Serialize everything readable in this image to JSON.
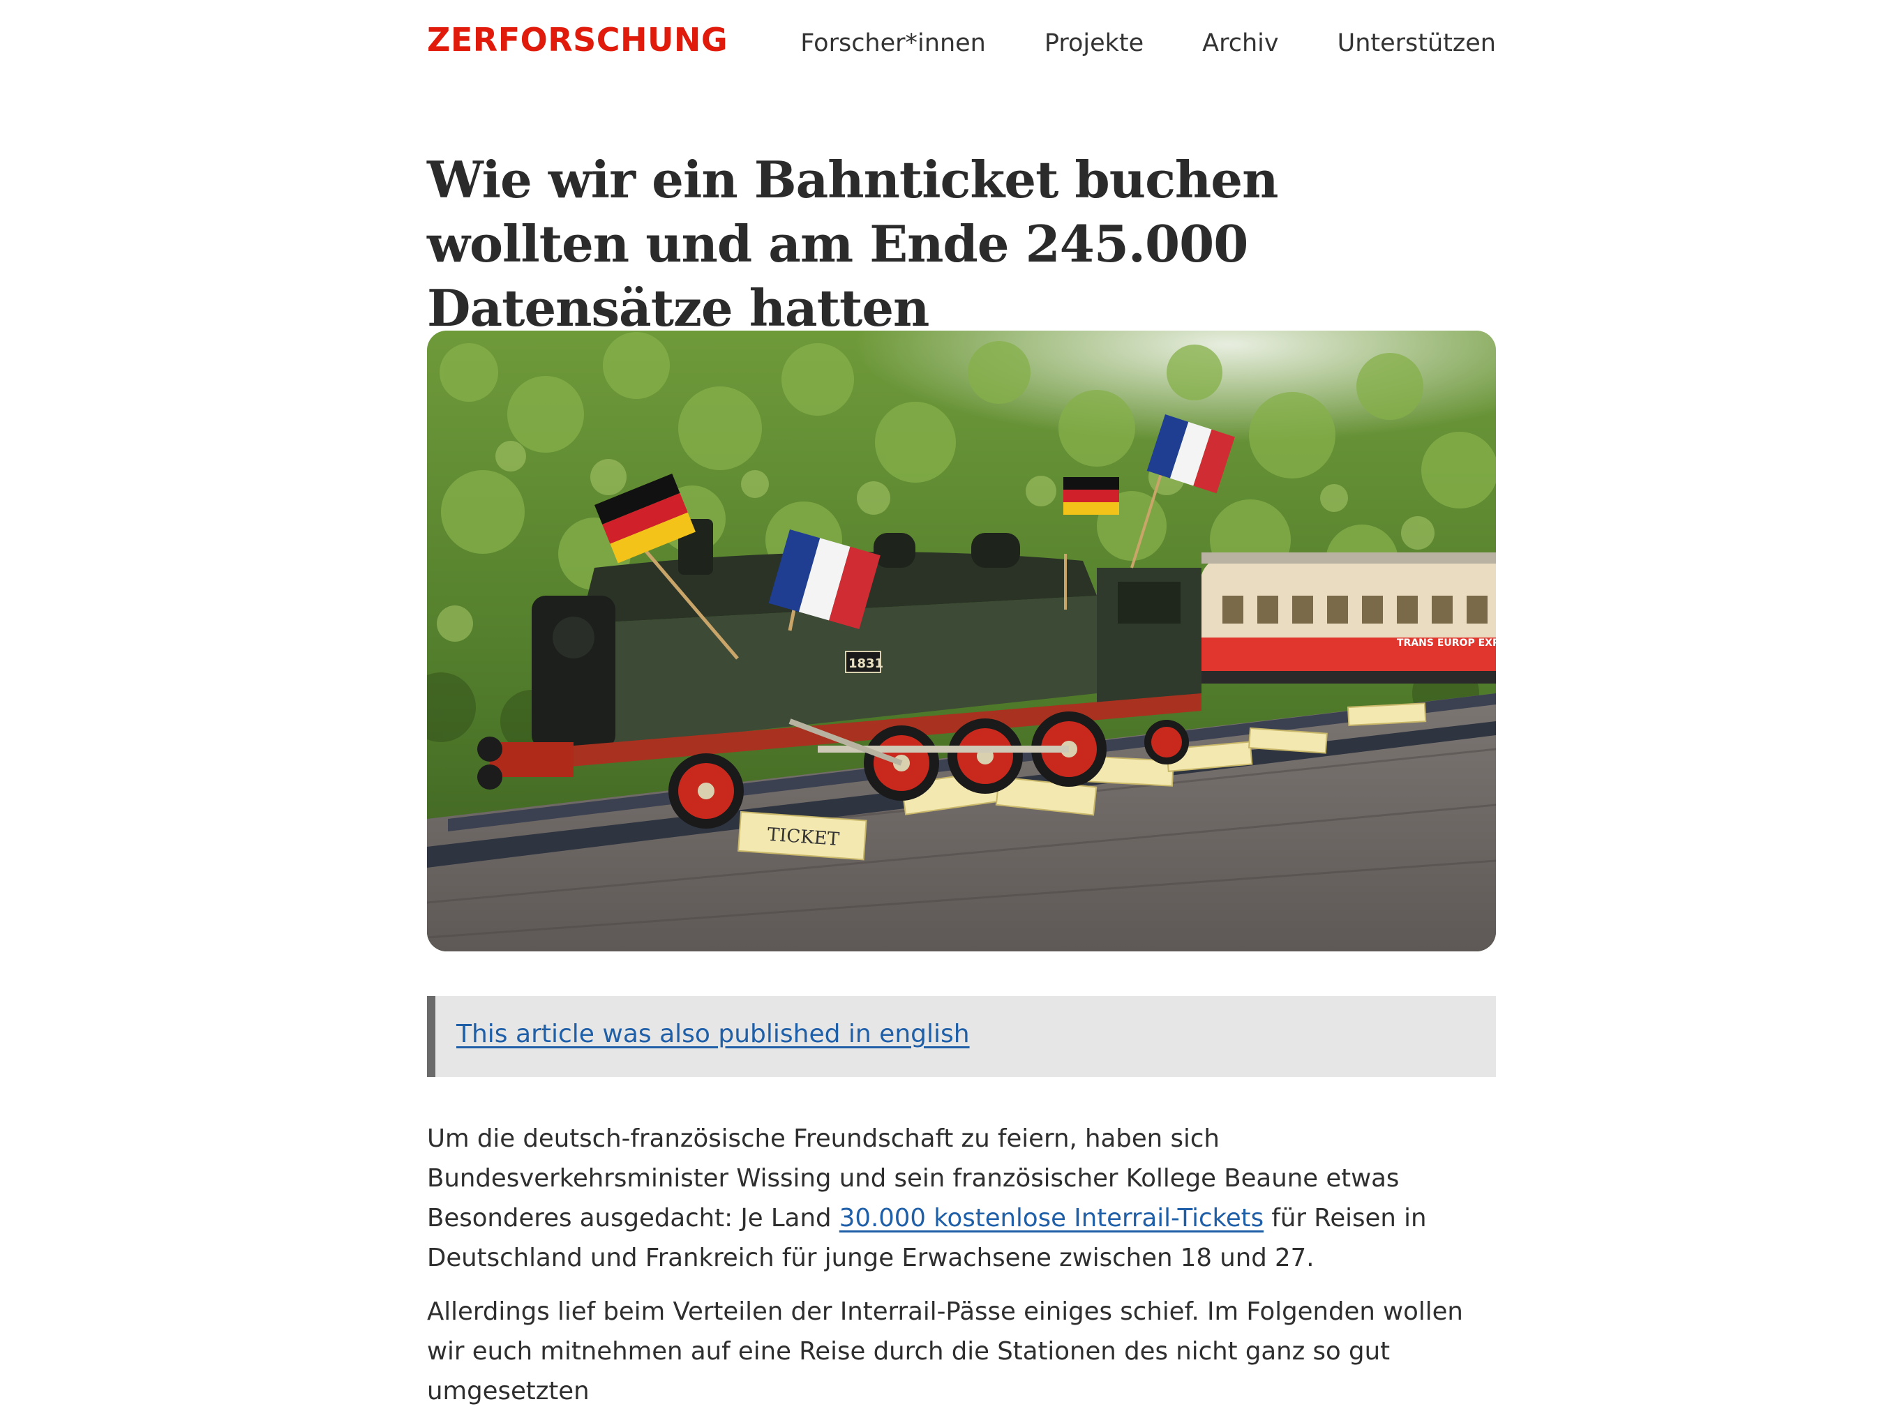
{
  "header": {
    "logo": "ZERFORSCHUNG",
    "nav": [
      {
        "label": "Forscher*innen"
      },
      {
        "label": "Projekte"
      },
      {
        "label": "Archiv"
      },
      {
        "label": "Unterstützen"
      }
    ]
  },
  "article": {
    "title": "Wie wir ein Bahnticket buchen wollten und am Ende 245.000 Datensätze hatten",
    "hero": {
      "locomotive_number": "1831",
      "ticket_label": "TICKET",
      "coach_label": "TRANS EUROP EXP"
    },
    "callout_link": "This article was also published in english",
    "p1_before": "Um die deutsch-französische Freundschaft zu feiern, haben sich Bundesverkehrsminister Wissing und sein französischer Kollege Beaune etwas Besonderes ausgedacht: Je Land ",
    "p1_link": "30.000 kostenlose Interrail-Tickets",
    "p1_after": " für Reisen in Deutschland und Frankreich für junge Erwachsene zwischen 18 und 27.",
    "p2": "Allerdings lief beim Verteilen der Interrail-Pässe einiges schief. Im Folgenden wollen wir euch mitnehmen auf eine Reise durch die Stationen des nicht ganz so gut umgesetzten"
  },
  "colors": {
    "brand": "#e01b0b",
    "link": "#1f5fa8",
    "callout_bg": "#e6e6e6",
    "callout_border": "#6a6a6a"
  }
}
